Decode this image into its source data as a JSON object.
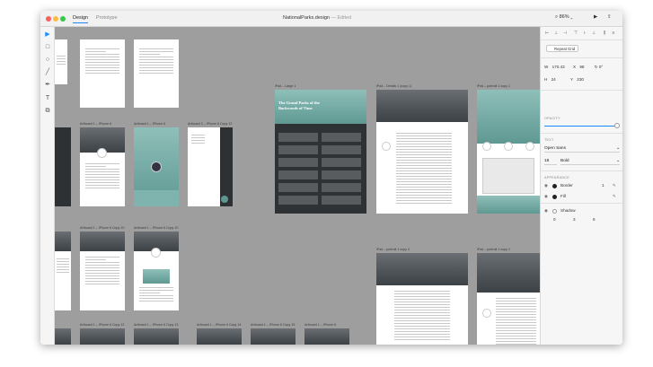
{
  "window": {
    "title": "NationalParks.design",
    "title_status": "— Edited",
    "tabs": [
      {
        "label": "Design",
        "active": true
      },
      {
        "label": "Prototype",
        "active": false
      }
    ],
    "zoom": "86%"
  },
  "toolbar": {
    "tools": [
      {
        "name": "select-tool",
        "glyph": "▶"
      },
      {
        "name": "rectangle-tool",
        "glyph": "□"
      },
      {
        "name": "ellipse-tool",
        "glyph": "○"
      },
      {
        "name": "line-tool",
        "glyph": "╱"
      },
      {
        "name": "pen-tool",
        "glyph": "✒"
      },
      {
        "name": "text-tool",
        "glyph": "T"
      },
      {
        "name": "artboard-tool",
        "glyph": "⧉"
      }
    ]
  },
  "canvas": {
    "artboard_labels": {
      "a1": "Artboard 1 – iPhone 6",
      "a2": "Artboard 1 – iPhone 6",
      "a3": "Artboard 2 – iPhone 6 Copy 12",
      "a4": "Artboard 1 – iPhone 6 Copy 10",
      "a5": "Artboard 1 – iPhone 6 Copy 10",
      "a6": "Artboard 1 – iPhone 6 Copy 13",
      "a7": "Artboard 1 – iPhone 6 Copy 13",
      "a8": "Artboard 1 – iPhone 6 Copy 14",
      "a9": "Artboard 1 – iPhone 6 Copy 15",
      "a10": "Artboard 1 – iPhone 6",
      "ipad1": "iPad – Large 1",
      "ipad2": "iPad – Details 1 (copy 1)",
      "ipad3": "iPad – portrait 1 copy 1",
      "ipad4": "iPad – portrait 1 copy 4",
      "ipad5": "iPad – portrait 1 copy 2"
    },
    "hero_heading": "The Grand Parks of the",
    "hero_heading2": "Backwoods of Time"
  },
  "inspector": {
    "repeat_grid_label": "Repeat Grid",
    "width_label": "W",
    "width_value": "170.43",
    "x_label": "X",
    "x_value": "98",
    "rotation_value": "0°",
    "height_label": "H",
    "height_value": "24",
    "y_label": "Y",
    "y_value": "230",
    "opacity_section": "OPACITY",
    "opacity_fraction": 1.0,
    "text_section": "TEXT",
    "font_family": "Open Sans",
    "font_size": "18",
    "font_weight": "Bold",
    "appearance_section": "APPEARANCE",
    "border_label": "Border",
    "border_width": "1",
    "fill_label": "Fill",
    "shadow_label": "Shadow",
    "shadow_x": "0",
    "shadow_y": "3",
    "shadow_blur": "6"
  },
  "colors": {
    "accent": "#1a8cff",
    "canvas": "#9e9e9e",
    "teal": "#5f9892"
  }
}
